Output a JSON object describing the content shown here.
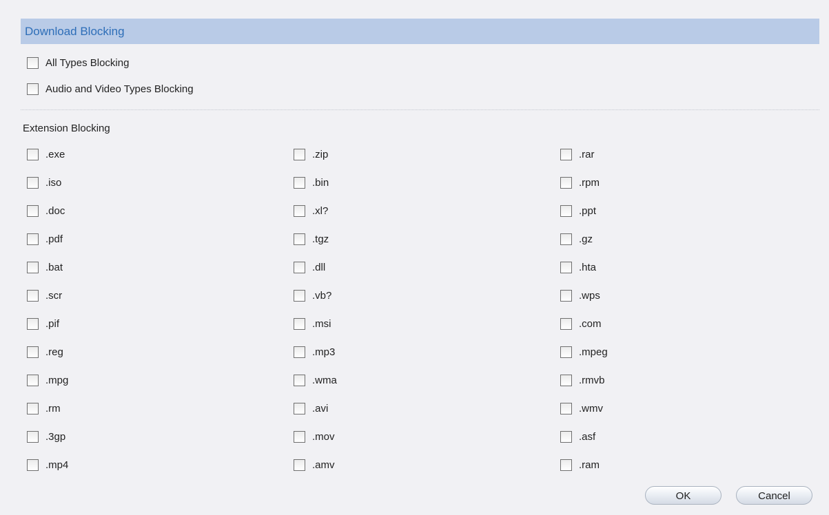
{
  "section": {
    "title": "Download Blocking"
  },
  "options": {
    "all_types": {
      "label": "All Types Blocking",
      "checked": false
    },
    "audio_video": {
      "label": "Audio and Video Types Blocking",
      "checked": false
    }
  },
  "extension_blocking": {
    "title": "Extension Blocking",
    "columns": [
      [
        ".exe",
        ".iso",
        ".doc",
        ".pdf",
        ".bat",
        ".scr",
        ".pif",
        ".reg",
        ".mpg",
        ".rm",
        ".3gp",
        ".mp4"
      ],
      [
        ".zip",
        ".bin",
        ".xl?",
        ".tgz",
        ".dll",
        ".vb?",
        ".msi",
        ".mp3",
        ".wma",
        ".avi",
        ".mov",
        ".amv"
      ],
      [
        ".rar",
        ".rpm",
        ".ppt",
        ".gz",
        ".hta",
        ".wps",
        ".com",
        ".mpeg",
        ".rmvb",
        ".wmv",
        ".asf",
        ".ram"
      ]
    ]
  },
  "buttons": {
    "ok": "OK",
    "cancel": "Cancel"
  },
  "colors": {
    "header_bg": "#b9cbe7",
    "header_text": "#2e6eb8",
    "page_bg": "#f1f1f4"
  }
}
